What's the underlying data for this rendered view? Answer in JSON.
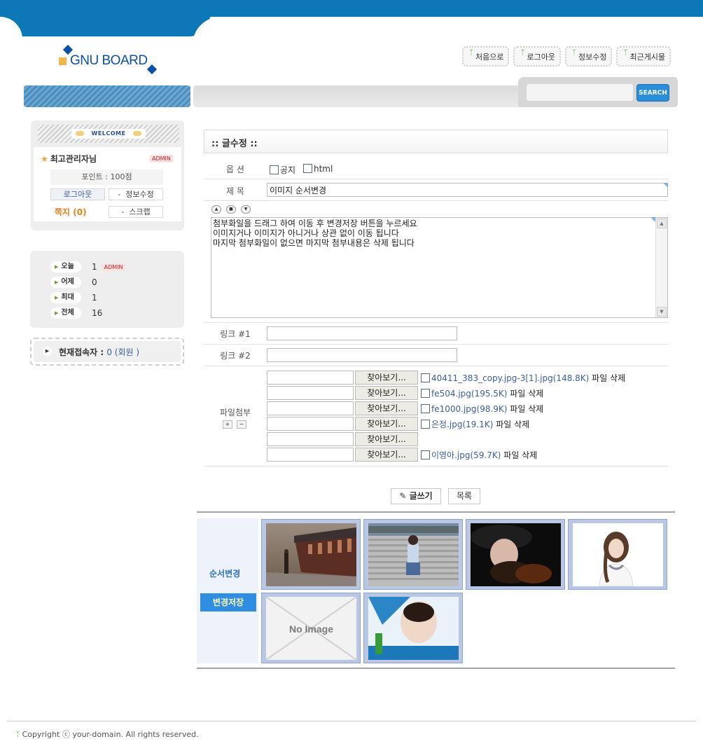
{
  "logo": {
    "text": "GNU BOARD"
  },
  "topnav": [
    {
      "label": "처음으로"
    },
    {
      "label": "로그아웃"
    },
    {
      "label": "정보수정"
    },
    {
      "label": "최근게시물"
    }
  ],
  "search": {
    "button": "SEARCH",
    "value": ""
  },
  "login": {
    "welcome": "WELCOME",
    "nickname": "최고관리자님",
    "badge": "ADMIN",
    "point": "포인트 : 100점",
    "logout": "로그아웃",
    "edit": "정보수정",
    "memo": "쪽지 (0)",
    "scrap": "스크랩",
    "dash": "-"
  },
  "counter": [
    {
      "label": "오늘",
      "value": "1",
      "badge": "ADMIN"
    },
    {
      "label": "어제",
      "value": "0"
    },
    {
      "label": "최대",
      "value": "1"
    },
    {
      "label": "전체",
      "value": "16"
    }
  ],
  "connect": {
    "label": "현재접속자 : ",
    "value": "0 (회원 )"
  },
  "form": {
    "title": ":: 글수정 ::",
    "option_label": "옵 션",
    "notice": "공지",
    "html": "html",
    "subject_label": "제 목",
    "subject": "이미지 순서변경",
    "content": "첨부화일을 드래그 하여 이동 후 변경저장 버튼을 누르세요\n이미지거나 이미지가 아니거나 상관 없이 이동 됩니다\n마지막 첨부화일이 없으면 마지막 첨부내용은 삭제 됩니다",
    "link1_label": "링크 #1",
    "link2_label": "링크 #2",
    "file_label": "파일첨부",
    "find_button": "찾아보기...",
    "delete_suffix": " 파일 삭제",
    "files": [
      {
        "name": "40411_383_copy.jpg-3[1].jpg(148.8K)"
      },
      {
        "name": "fe504.jpg(195.5K)"
      },
      {
        "name": "fe1000.jpg(98.9K)"
      },
      {
        "name": "은정.jpg(19.1K)"
      },
      {
        "name": ""
      },
      {
        "name": "이영아.jpg(59.7K)"
      }
    ],
    "write_button": "글쓰기",
    "list_button": "목록"
  },
  "gallery": {
    "order_label": "순서변경",
    "save_button": "변경저장",
    "noimage": "No Image"
  },
  "footer": {
    "text": "Copyright ⓒ your-domain. All rights reserved."
  }
}
